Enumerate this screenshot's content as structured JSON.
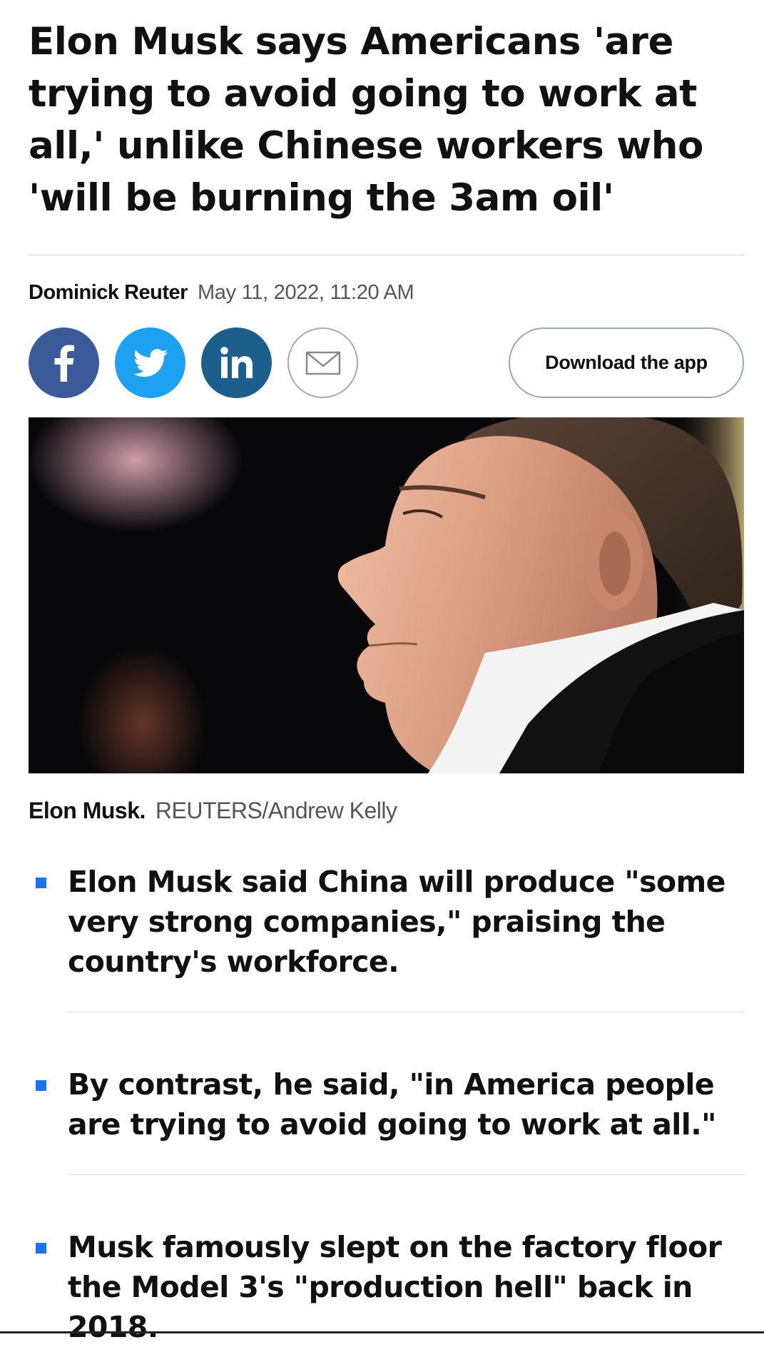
{
  "article": {
    "headline": "Elon Musk says Americans 'are trying to avoid going to work at all,' unlike Chinese workers who 'will be burning the 3am oil'",
    "author": "Dominick Reuter",
    "date": "May 11, 2022, 11:20 AM"
  },
  "share": {
    "facebook_icon": "facebook-icon",
    "twitter_icon": "twitter-icon",
    "linkedin_icon": "linkedin-icon",
    "email_icon": "email-icon",
    "download_label": "Download the app"
  },
  "photo": {
    "caption_subject": "Elon Musk.",
    "caption_credit": "REUTERS/Andrew Kelly"
  },
  "key_points": [
    {
      "text": "Elon Musk said China will produce \"some very strong companies,\" praising the country's workforce."
    },
    {
      "text": "By contrast, he said, \"in America people are trying to avoid going to work at all.\""
    },
    {
      "text": "Musk famously slept on the factory floor the Model 3's \"production hell\" back in 2018."
    }
  ],
  "colors": {
    "facebook": "#3b5a9a",
    "twitter": "#1da1f2",
    "linkedin": "#1c5f8c",
    "bullet_marker": "#1a73e8"
  }
}
